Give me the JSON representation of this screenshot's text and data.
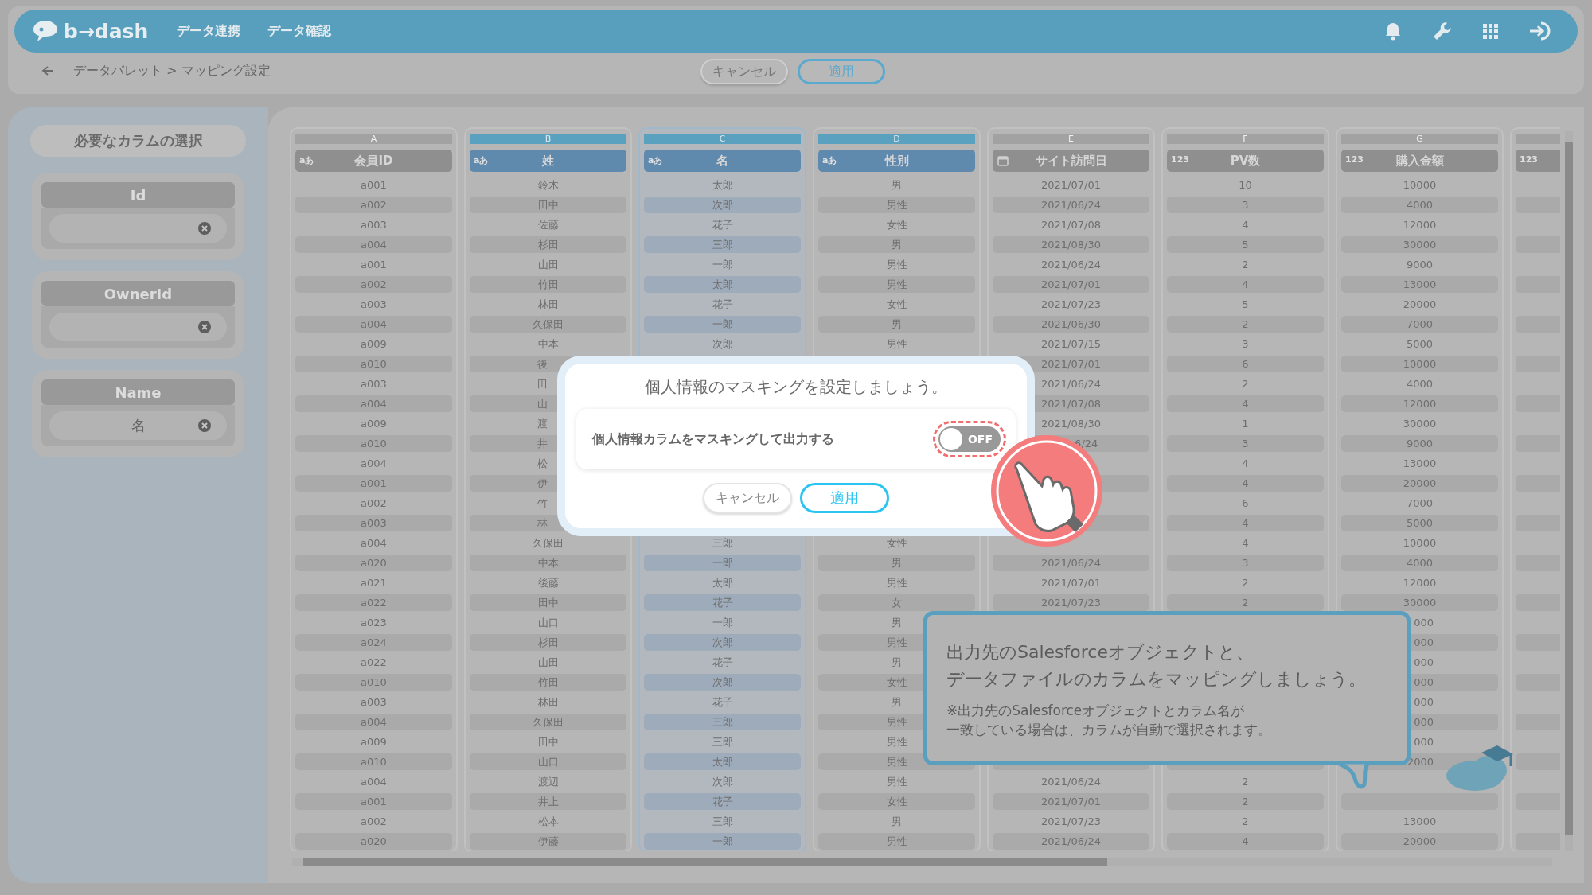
{
  "header": {
    "logo": "b→dash",
    "menu": [
      "データ連携",
      "データ確認"
    ]
  },
  "breadcrumb": {
    "path": "データパレット > マッピング設定",
    "buttons": [
      {
        "label": "キャンセル",
        "kind": "secondary"
      },
      {
        "label": "適用",
        "kind": "primary"
      }
    ]
  },
  "sidebar": {
    "title": "必要なカラムの選択",
    "fields": [
      {
        "label": "Id"
      },
      {
        "label": "OwnerId"
      },
      {
        "label": "Name",
        "value": "名"
      }
    ]
  },
  "table": {
    "columns": [
      {
        "letter": "A",
        "name": "会員ID",
        "kind": "text",
        "type_label": "aあ",
        "mapped": false,
        "selected": false
      },
      {
        "letter": "B",
        "name": "姓",
        "kind": "text",
        "type_label": "aあ",
        "mapped": true,
        "selected": false
      },
      {
        "letter": "C",
        "name": "名",
        "kind": "text",
        "type_label": "aあ",
        "mapped": true,
        "selected": true
      },
      {
        "letter": "D",
        "name": "性別",
        "kind": "text",
        "type_label": "aあ",
        "mapped": true,
        "selected": false
      },
      {
        "letter": "E",
        "name": "サイト訪問日",
        "kind": "date",
        "mapped": false,
        "selected": false
      },
      {
        "letter": "F",
        "name": "PV数",
        "kind": "number",
        "type_label": "123",
        "mapped": false,
        "selected": false
      },
      {
        "letter": "G",
        "name": "購入金額",
        "kind": "number",
        "type_label": "123",
        "mapped": false,
        "selected": false
      },
      {
        "kind": "number",
        "type_label": "123",
        "mapped": false,
        "selected": false
      }
    ],
    "rows": [
      [
        "a001",
        "鈴木",
        "太郎",
        "男",
        "2021/07/01",
        "10",
        "10000",
        null
      ],
      [
        "a002",
        "田中",
        "次郎",
        "男性",
        "2021/06/24",
        "3",
        "4000",
        null
      ],
      [
        "a003",
        "佐藤",
        "花子",
        "女性",
        "2021/07/08",
        "4",
        "12000",
        null
      ],
      [
        "a004",
        "杉田",
        "三郎",
        "男",
        "2021/08/30",
        "5",
        "30000",
        null
      ],
      [
        "a001",
        "山田",
        "一郎",
        "男性",
        "2021/06/24",
        "2",
        "9000",
        null
      ],
      [
        "a002",
        "竹田",
        "太郎",
        "男性",
        "2021/07/01",
        "4",
        "13000",
        null
      ],
      [
        "a003",
        "林田",
        "花子",
        "女性",
        "2021/07/23",
        "5",
        "20000",
        null
      ],
      [
        "a004",
        "久保田",
        "一郎",
        "男",
        "2021/06/30",
        "2",
        "7000",
        null
      ],
      [
        "a009",
        "中本",
        "次郎",
        "男性",
        "2021/07/15",
        "3",
        "5000",
        null
      ],
      [
        "a010",
        {
          "text": "後",
          "kind": "clipped_end"
        },
        null,
        null,
        "2021/07/01",
        "6",
        "10000",
        null
      ],
      [
        "a003",
        {
          "text": "田",
          "kind": "clipped_end"
        },
        null,
        null,
        "2021/06/24",
        "2",
        "4000",
        null
      ],
      [
        "a004",
        {
          "text": "山",
          "kind": "clipped_end"
        },
        null,
        null,
        "2021/07/08",
        "4",
        "12000",
        null
      ],
      [
        "a009",
        {
          "text": "渡",
          "kind": "clipped_end"
        },
        null,
        null,
        "2021/08/30",
        "1",
        "30000",
        null
      ],
      [
        "a010",
        {
          "text": "井",
          "kind": "clipped_end"
        },
        null,
        null,
        {
          "text": "6/24",
          "kind": "clipped_start"
        },
        "3",
        "9000",
        null
      ],
      [
        "a004",
        {
          "text": "松",
          "kind": "clipped_end"
        },
        null,
        null,
        null,
        "4",
        "13000",
        null
      ],
      [
        "a001",
        {
          "text": "伊",
          "kind": "clipped_end"
        },
        null,
        null,
        null,
        "4",
        "20000",
        null
      ],
      [
        "a002",
        {
          "text": "竹",
          "kind": "clipped_end"
        },
        null,
        null,
        null,
        "6",
        "7000",
        null
      ],
      [
        "a003",
        {
          "text": "林",
          "kind": "clipped_end"
        },
        null,
        null,
        null,
        "4",
        "5000",
        null
      ],
      [
        "a004",
        "久保田",
        "三郎",
        "女性",
        null,
        "4",
        "10000",
        null
      ],
      [
        "a020",
        "中本",
        "一郎",
        "男",
        "2021/06/24",
        "3",
        "4000",
        null
      ],
      [
        "a021",
        "後藤",
        "太郎",
        "男性",
        "2021/07/01",
        "2",
        "12000",
        null
      ],
      [
        "a022",
        "田中",
        "花子",
        "女",
        "2021/07/23",
        "2",
        "30000",
        null
      ],
      [
        "a023",
        "山口",
        "一郎",
        "男",
        null,
        null,
        {
          "text": "000",
          "kind": "clipped_start"
        },
        null
      ],
      [
        "a024",
        "杉田",
        "次郎",
        "男性",
        null,
        null,
        {
          "text": "000",
          "kind": "clipped_start"
        },
        null
      ],
      [
        "a022",
        "山田",
        "花子",
        "男",
        null,
        null,
        {
          "text": "000",
          "kind": "clipped_start"
        },
        null
      ],
      [
        "a010",
        "竹田",
        "次郎",
        "女性",
        null,
        null,
        {
          "text": "000",
          "kind": "clipped_start"
        },
        null
      ],
      [
        "a003",
        "林田",
        "花子",
        "男",
        null,
        null,
        {
          "text": "000",
          "kind": "clipped_start"
        },
        null
      ],
      [
        "a004",
        "久保田",
        "三郎",
        "男性",
        null,
        null,
        {
          "text": "000",
          "kind": "clipped_start"
        },
        null
      ],
      [
        "a009",
        "田中",
        "三郎",
        "男性",
        null,
        null,
        {
          "text": "000",
          "kind": "clipped_start"
        },
        null
      ],
      [
        "a010",
        "山口",
        "太郎",
        "男性",
        null,
        null,
        {
          "text": "2000",
          "kind": "clipped_start"
        },
        null
      ],
      [
        "a004",
        "渡辺",
        "次郎",
        "男性",
        "2021/06/24",
        "2",
        null,
        null
      ],
      [
        "a001",
        "井上",
        "花子",
        "女性",
        "2021/07/01",
        "2",
        null,
        null
      ],
      [
        "a002",
        "松本",
        "三郎",
        "男",
        "2021/07/23",
        "2",
        "13000",
        null
      ],
      [
        "a020",
        "伊藤",
        "一郎",
        "男性",
        "2021/06/24",
        "4",
        "20000",
        null
      ]
    ]
  },
  "dialog": {
    "title": "個人情報のマスキングを設定しましょう。",
    "option": {
      "label": "個人情報カラムをマスキングして出力する",
      "on": false,
      "state_label": "OFF",
      "highlighted": true
    },
    "buttons": [
      {
        "label": "キャンセル",
        "kind": "secondary"
      },
      {
        "label": "適用",
        "kind": "primary"
      }
    ]
  },
  "tooltip": {
    "paragraphs": [
      {
        "lines": [
          "出力先のSalesforceオブジェクトと、",
          "データファイルのカラムをマッピングしましょう。"
        ],
        "kind": "lead"
      },
      {
        "lines": [
          "※出力先のSalesforceオブジェクトとカラム名が",
          "一致している場合は、カラムが自動で選択されます。"
        ],
        "kind": "note"
      }
    ]
  }
}
